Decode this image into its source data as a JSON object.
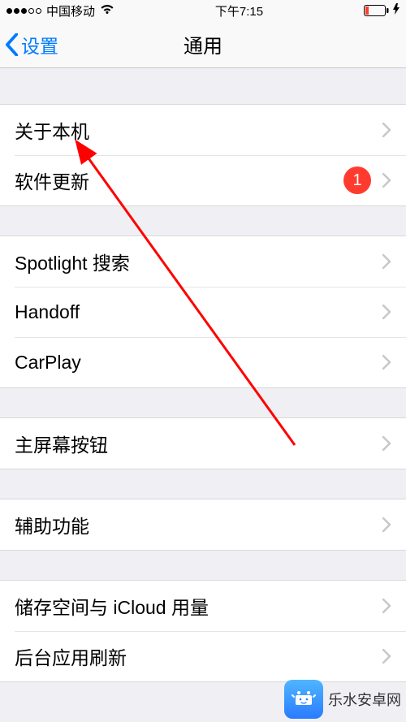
{
  "status_bar": {
    "carrier": "中国移动",
    "time": "下午7:15"
  },
  "nav": {
    "back_label": "设置",
    "title": "通用"
  },
  "groups": [
    [
      {
        "label": "关于本机",
        "badge": null
      },
      {
        "label": "软件更新",
        "badge": "1"
      }
    ],
    [
      {
        "label": "Spotlight 搜索",
        "badge": null
      },
      {
        "label": "Handoff",
        "badge": null
      },
      {
        "label": "CarPlay",
        "badge": null
      }
    ],
    [
      {
        "label": "主屏幕按钮",
        "badge": null
      }
    ],
    [
      {
        "label": "辅助功能",
        "badge": null
      }
    ],
    [
      {
        "label": "储存空间与 iCloud 用量",
        "badge": null
      },
      {
        "label": "后台应用刷新",
        "badge": null
      }
    ]
  ],
  "watermark": {
    "text": "乐水安卓网"
  }
}
